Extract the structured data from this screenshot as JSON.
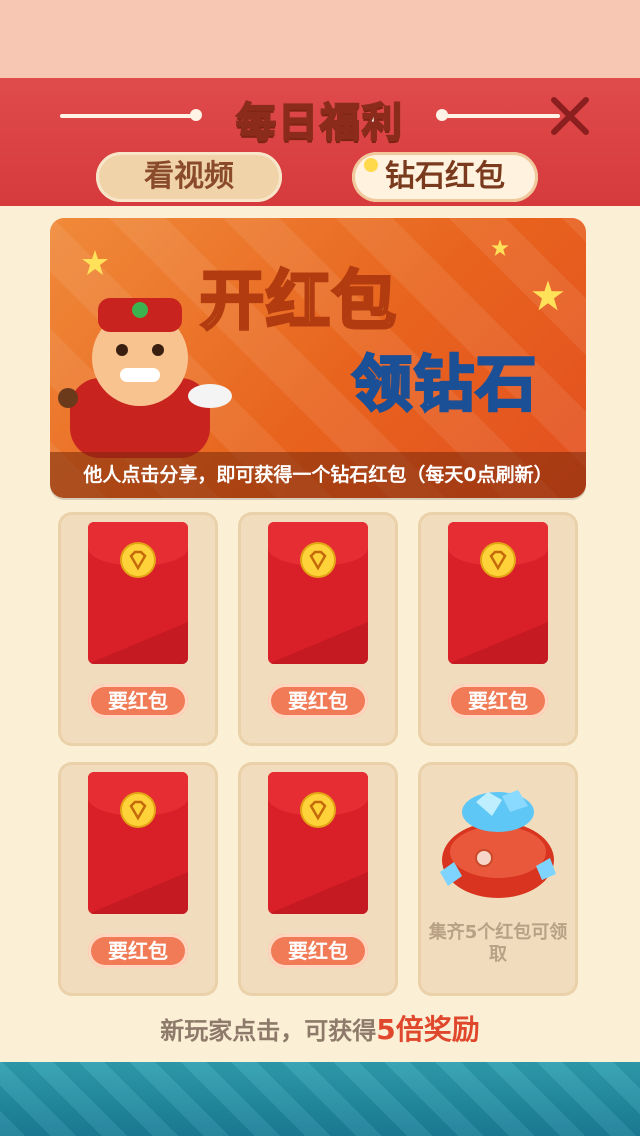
{
  "header": {
    "title": "每日福利"
  },
  "tabs": [
    {
      "label": "看视频"
    },
    {
      "label": "钻石红包"
    }
  ],
  "banner": {
    "line1": "开红包",
    "line2": "领钻石",
    "caption": "他人点击分享，即可获得一个钻石红包（每天0点刷新）"
  },
  "cards": [
    {
      "button": "要红包"
    },
    {
      "button": "要红包"
    },
    {
      "button": "要红包"
    },
    {
      "button": "要红包"
    },
    {
      "button": "要红包"
    },
    {
      "reward_text": "集齐5个红包可领取"
    }
  ],
  "footer": {
    "prefix": "新玩家点击，可获得",
    "highlight": "5倍奖励"
  },
  "colors": {
    "header_red": "#d63a3c",
    "panel_bg": "#fbefd6",
    "envelope_red": "#d91f27",
    "button_orange": "#f07b56",
    "highlight_red": "#e0482d"
  }
}
